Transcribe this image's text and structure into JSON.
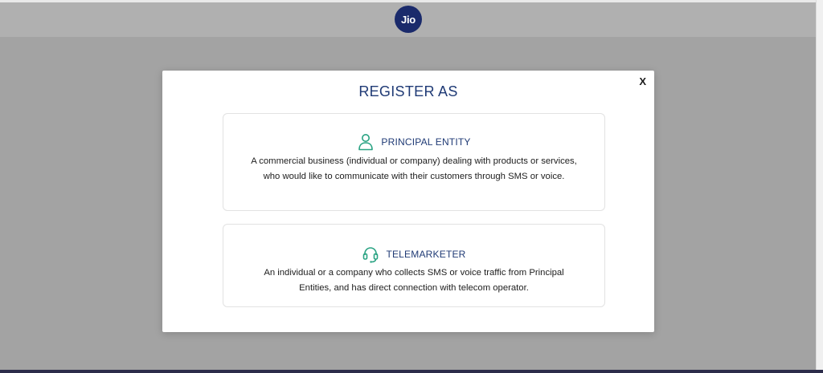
{
  "header": {
    "logo_text": "Jio",
    "logo_color": "#1a2a6b"
  },
  "modal": {
    "title": "REGISTER AS",
    "close_label": "X",
    "accent_color": "#1f3a75",
    "icon_color": "#2aa383",
    "options": [
      {
        "icon": "person-icon",
        "title": "PRINCIPAL ENTITY",
        "description": "A commercial business (individual or company) dealing with products or services, who would like to communicate with their customers through SMS or voice."
      },
      {
        "icon": "headset-icon",
        "title": "TELEMARKETER",
        "description": "An individual or a company who collects SMS or voice traffic from Principal Entities, and has direct connection with telecom operator."
      }
    ]
  }
}
